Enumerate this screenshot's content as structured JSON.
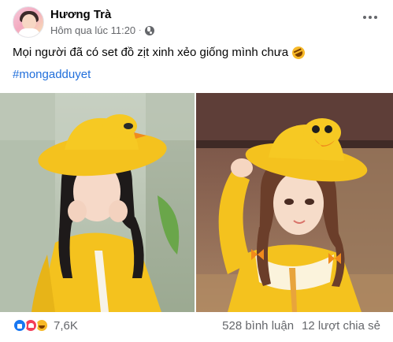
{
  "post": {
    "author": "Hương Trà",
    "timestamp": "Hôm qua lúc 11:20",
    "separator": "·",
    "privacy_icon": "globe-icon",
    "caption": "Mọi người đã có set đồ zịt xinh xẻo giống mình chưa",
    "caption_emoji": "rofl-icon",
    "hashtag": "#mongadduyet"
  },
  "reactions": {
    "icons": [
      "like-icon",
      "love-icon",
      "haha-icon"
    ],
    "count": "7,6K",
    "comments": "528 bình luận",
    "shares": "12 lượt chia sẻ"
  },
  "colors": {
    "link": "#216fdb",
    "secondary_text": "#65676b",
    "like": "#1877f2",
    "love": "#f33e58",
    "haha": "#f7b928",
    "duck_yellow": "#f4c21e"
  }
}
